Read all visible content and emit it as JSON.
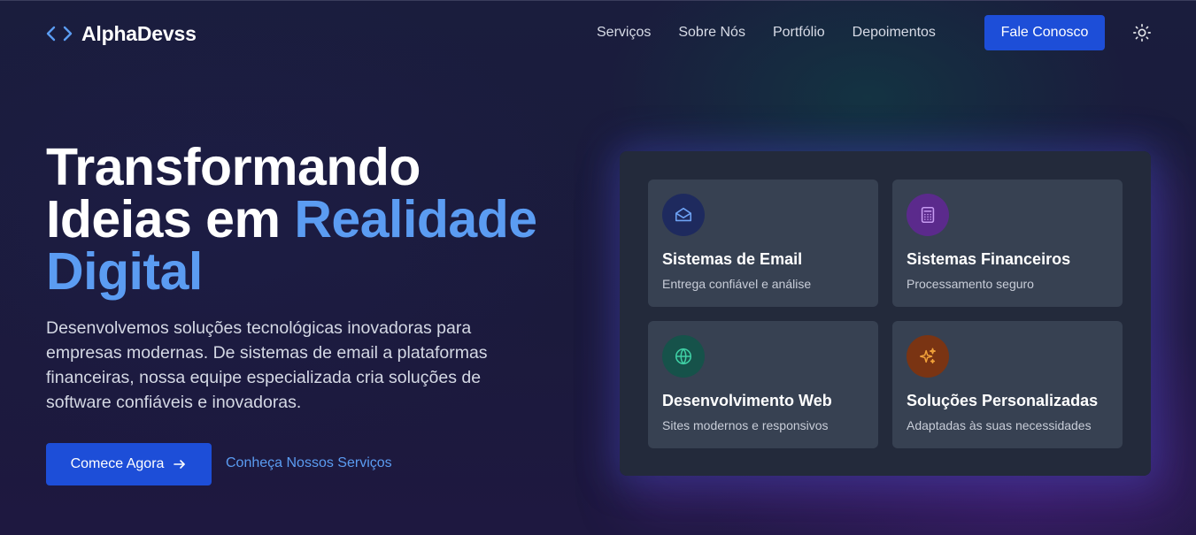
{
  "brand": {
    "name": "AlphaDevss",
    "icon": "code-brackets-icon"
  },
  "nav": {
    "items": [
      {
        "label": "Serviços"
      },
      {
        "label": "Sobre Nós"
      },
      {
        "label": "Portfólio"
      },
      {
        "label": "Depoimentos"
      }
    ],
    "cta_label": "Fale Conosco",
    "theme_icon": "sun-icon"
  },
  "hero": {
    "title_line1": "Transformando",
    "title_line2_plain": "Ideias em ",
    "title_line2_accent": "Realidade",
    "title_line3_accent": "Digital",
    "description": "Desenvolvemos soluções tecnológicas inovadoras para empresas modernas. De sistemas de email a plataformas financeiras, nossa equipe especializada cria soluções de software confiáveis e inovadoras.",
    "primary_button": "Comece Agora",
    "secondary_link": "Conheça Nossos Serviços"
  },
  "services": [
    {
      "title": "Sistemas de Email",
      "subtitle": "Entrega confiável e análise",
      "icon": "mail-open-icon",
      "bg": "#1e2a5e",
      "fg": "#6ea3f5"
    },
    {
      "title": "Sistemas Financeiros",
      "subtitle": "Processamento seguro",
      "icon": "calculator-icon",
      "bg": "#5b2a8c",
      "fg": "#c79bf2"
    },
    {
      "title": "Desenvolvimento Web",
      "subtitle": "Sites modernos e responsivos",
      "icon": "globe-icon",
      "bg": "#16524a",
      "fg": "#3fcfa4"
    },
    {
      "title": "Soluções Personalizadas",
      "subtitle": "Adaptadas às suas necessidades",
      "icon": "sparkles-icon",
      "bg": "#7a3413",
      "fg": "#f2a23a"
    }
  ],
  "colors": {
    "accent": "#5b9cf2",
    "button": "#1d4ed8",
    "panel": "#232a3b",
    "card": "#374152"
  }
}
